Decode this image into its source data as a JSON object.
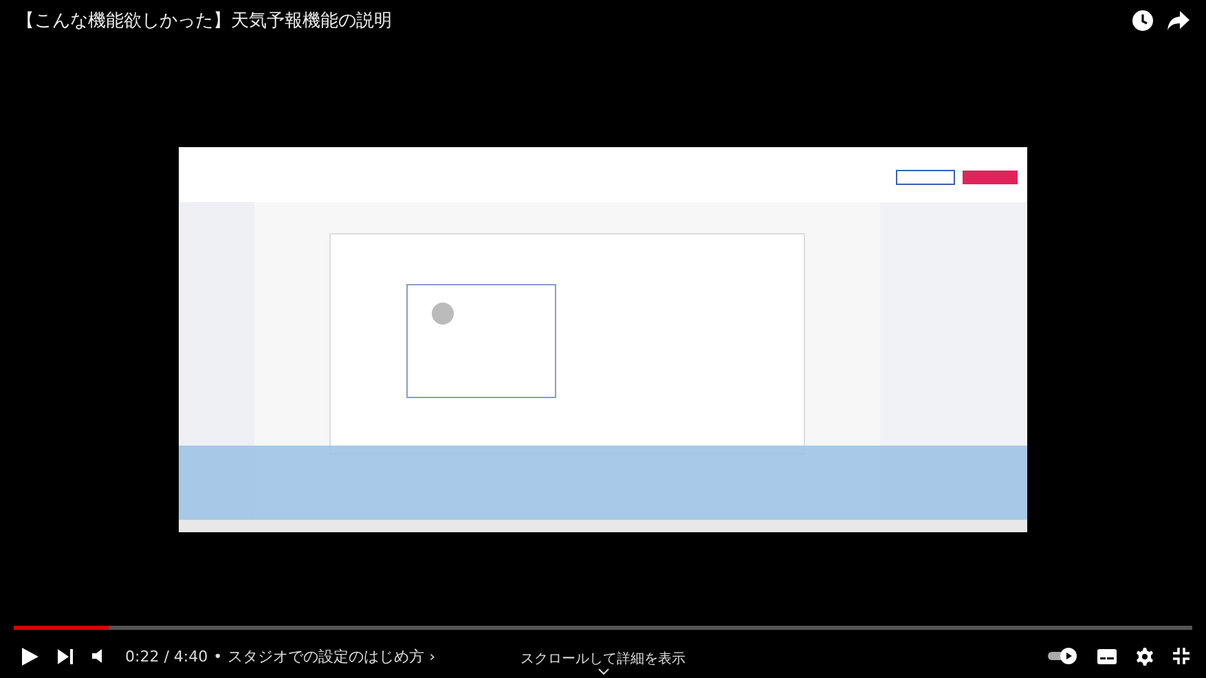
{
  "video": {
    "title": "【こんな機能欲しかった】天気予報機能の説明"
  },
  "progress": {
    "level": 0.08
  },
  "time": "0:22 / 4:40",
  "separator": "•",
  "chapter": "スタジオでの設定のはじめ方 ›",
  "scroll_hint": "スクロールして詳細を表示",
  "autoplay": {
    "on": true
  }
}
